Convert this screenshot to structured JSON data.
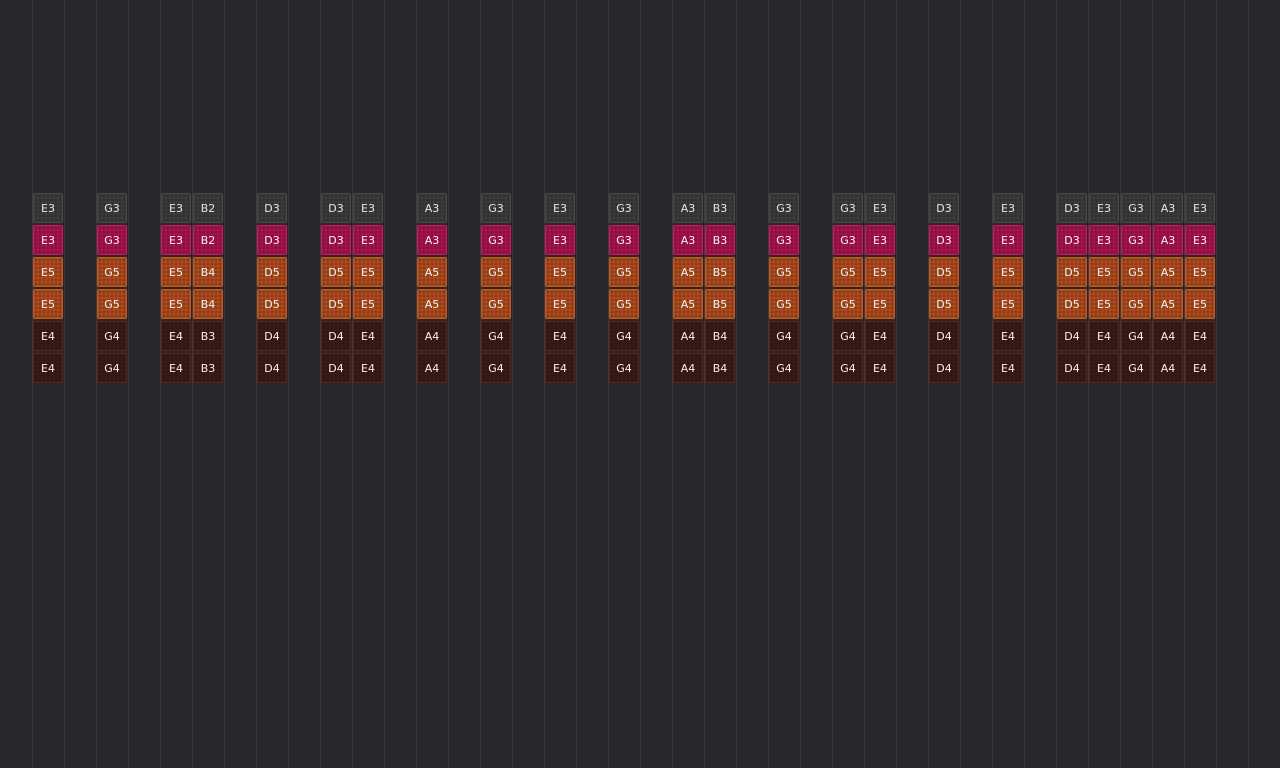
{
  "app": {
    "colors": {
      "background": "#272729",
      "grid_line": "#3a3a3d",
      "row_colors": [
        "#3a3a3a",
        "#a3124c",
        "#a84a1c",
        "#a84a1c",
        "#3a1a15",
        "#3a1a15"
      ]
    }
  },
  "steps": [
    {
      "chord": 1,
      "rows": [
        [
          "E3"
        ],
        [
          "E3"
        ],
        [
          "E5"
        ],
        [
          "E5"
        ],
        [
          "E4"
        ],
        [
          "E4"
        ]
      ]
    },
    {
      "chord": 3,
      "rows": [
        [
          "G3"
        ],
        [
          "G3"
        ],
        [
          "G5"
        ],
        [
          "G5"
        ],
        [
          "G4"
        ],
        [
          "G4"
        ]
      ]
    },
    {
      "chord": 5,
      "rows": [
        [
          "E3",
          "B2"
        ],
        [
          "E3",
          "B2"
        ],
        [
          "E5",
          "B4"
        ],
        [
          "E5",
          "B4"
        ],
        [
          "E4",
          "B3"
        ],
        [
          "E4",
          "B3"
        ]
      ]
    },
    {
      "chord": 8,
      "rows": [
        [
          "D3"
        ],
        [
          "D3"
        ],
        [
          "D5"
        ],
        [
          "D5"
        ],
        [
          "D4"
        ],
        [
          "D4"
        ]
      ]
    },
    {
      "chord": 10,
      "rows": [
        [
          "D3",
          "E3"
        ],
        [
          "D3",
          "E3"
        ],
        [
          "D5",
          "E5"
        ],
        [
          "D5",
          "E5"
        ],
        [
          "D4",
          "E4"
        ],
        [
          "D4",
          "E4"
        ]
      ]
    },
    {
      "chord": 13,
      "rows": [
        [
          "A3"
        ],
        [
          "A3"
        ],
        [
          "A5"
        ],
        [
          "A5"
        ],
        [
          "A4"
        ],
        [
          "A4"
        ]
      ]
    },
    {
      "chord": 15,
      "rows": [
        [
          "G3"
        ],
        [
          "G3"
        ],
        [
          "G5"
        ],
        [
          "G5"
        ],
        [
          "G4"
        ],
        [
          "G4"
        ]
      ]
    },
    {
      "chord": 17,
      "rows": [
        [
          "E3"
        ],
        [
          "E3"
        ],
        [
          "E5"
        ],
        [
          "E5"
        ],
        [
          "E4"
        ],
        [
          "E4"
        ]
      ]
    },
    {
      "chord": 19,
      "rows": [
        [
          "G3"
        ],
        [
          "G3"
        ],
        [
          "G5"
        ],
        [
          "G5"
        ],
        [
          "G4"
        ],
        [
          "G4"
        ]
      ]
    },
    {
      "chord": 21,
      "rows": [
        [
          "A3",
          "B3"
        ],
        [
          "A3",
          "B3"
        ],
        [
          "A5",
          "B5"
        ],
        [
          "A5",
          "B5"
        ],
        [
          "A4",
          "B4"
        ],
        [
          "A4",
          "B4"
        ]
      ]
    },
    {
      "chord": 24,
      "rows": [
        [
          "G3"
        ],
        [
          "G3"
        ],
        [
          "G5"
        ],
        [
          "G5"
        ],
        [
          "G4"
        ],
        [
          "G4"
        ]
      ]
    },
    {
      "chord": 26,
      "rows": [
        [
          "G3",
          "E3"
        ],
        [
          "G3",
          "E3"
        ],
        [
          "G5",
          "E5"
        ],
        [
          "G5",
          "E5"
        ],
        [
          "G4",
          "E4"
        ],
        [
          "G4",
          "E4"
        ]
      ]
    },
    {
      "chord": 29,
      "rows": [
        [
          "D3"
        ],
        [
          "D3"
        ],
        [
          "D5"
        ],
        [
          "D5"
        ],
        [
          "D4"
        ],
        [
          "D4"
        ]
      ]
    },
    {
      "chord": 31,
      "rows": [
        [
          "E3"
        ],
        [
          "E3"
        ],
        [
          "E5"
        ],
        [
          "E5"
        ],
        [
          "E4"
        ],
        [
          "E4"
        ]
      ]
    },
    {
      "chord": 33,
      "rows": [
        [
          "D3",
          "E3",
          "G3",
          "A3",
          "E3"
        ],
        [
          "D3",
          "E3",
          "G3",
          "A3",
          "E3"
        ],
        [
          "D5",
          "E5",
          "G5",
          "A5",
          "E5"
        ],
        [
          "D5",
          "E5",
          "G5",
          "A5",
          "E5"
        ],
        [
          "D4",
          "E4",
          "G4",
          "A4",
          "E4"
        ],
        [
          "D4",
          "E4",
          "G4",
          "A4",
          "E4"
        ]
      ]
    }
  ]
}
